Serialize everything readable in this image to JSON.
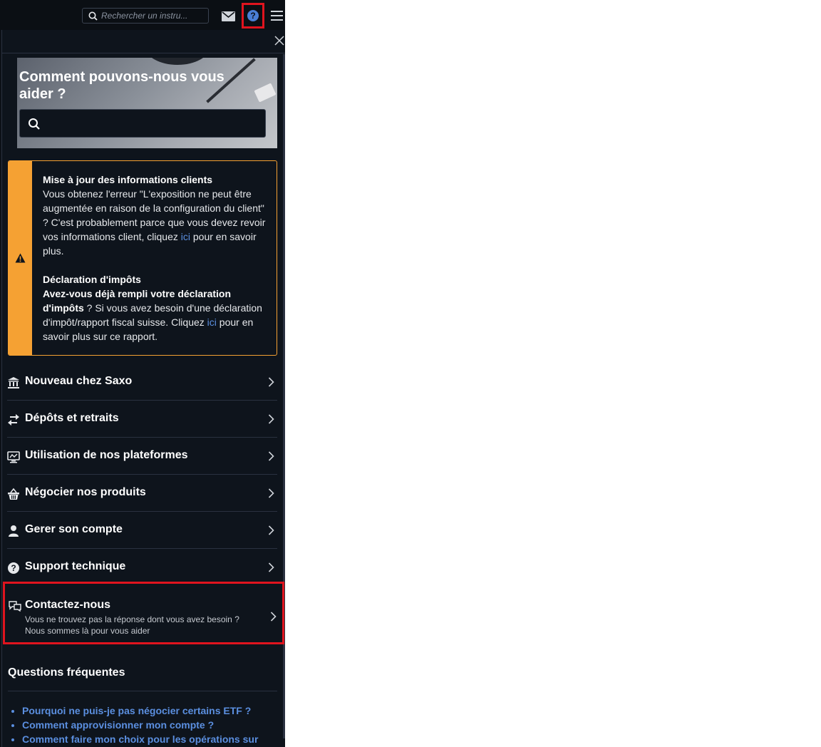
{
  "topbar": {
    "search_placeholder": "Rechercher un instru..."
  },
  "hero": {
    "title": "Comment pouvons-nous vous aider ?"
  },
  "alert": {
    "title1": "Mise à jour des informations clients",
    "text1": "Vous obtenez l'erreur \"L'exposition ne peut être augmentée en raison de la configuration du client\" ? C'est probablement parce que vous devez revoir vos informations client, cliquez",
    "link1": "ici",
    "text1_end": "pour en savoir plus.",
    "title2": "Déclaration d'impôts",
    "bold2": "Avez-vous déjà rempli votre déclaration d'impôts",
    "text2": "? Si vous avez besoin d'une déclaration d'impôt/rapport fiscal suisse. Cliquez",
    "link2": "ici",
    "text2_end": "pour en savoir plus sur ce rapport."
  },
  "menu": {
    "items": [
      {
        "label": "Nouveau chez Saxo",
        "icon": "bank-icon"
      },
      {
        "label": "Dépôts et retraits",
        "icon": "transfer-icon"
      },
      {
        "label": "Utilisation de nos plateformes",
        "icon": "monitor-icon"
      },
      {
        "label": "Négocier nos produits",
        "icon": "basket-icon"
      },
      {
        "label": "Gerer son compte",
        "icon": "user-icon"
      },
      {
        "label": "Support technique",
        "icon": "question-icon"
      }
    ]
  },
  "contact": {
    "label": "Contactez-nous",
    "sub1": "Vous ne trouvez pas la réponse dont vous avez besoin ?",
    "sub2": "Nous sommes là pour vous aider"
  },
  "faq": {
    "title": "Questions fréquentes",
    "items": [
      "Pourquoi ne puis-je pas négocier certains ETF ?",
      "Comment approvisionner mon compte ?",
      "Comment faire mon choix pour les opérations sur"
    ]
  },
  "colors": {
    "accent": "#4a7fd4",
    "warning": "#f5a133",
    "highlight": "#e0141e",
    "link": "#5b8fe0"
  }
}
